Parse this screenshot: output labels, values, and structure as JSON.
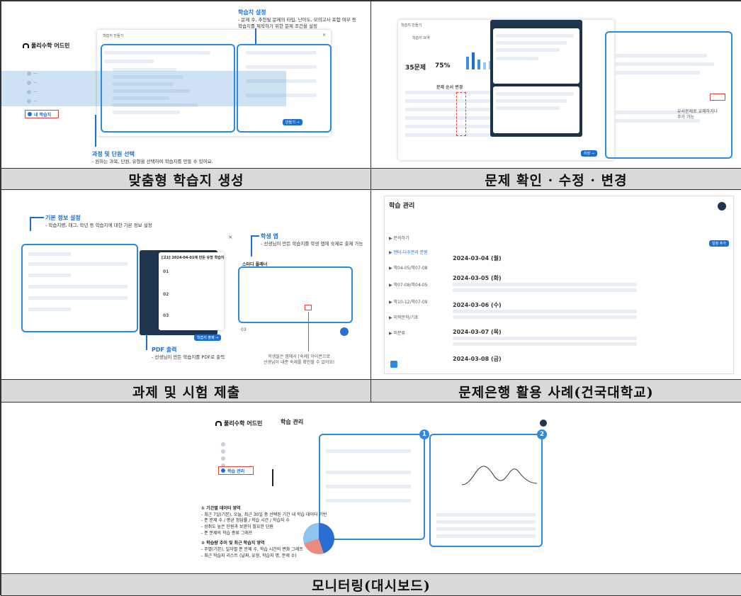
{
  "captions": {
    "c1": "맞춤형 학습지 생성",
    "c2": "문제 확인 · 수정 · 변경",
    "c3": "과제 및 시험 제출",
    "c4": "문제은행 활용 사례(건국대학교)",
    "c5": "모니터링(대시보드)"
  },
  "brand": "풀리수학 어드민",
  "p1": {
    "callout1_title": "학습지 설정",
    "callout1_desc1": "- 문제 수, 추천될 문제의 타입, 난이도, 모의고사 포함 여부 등",
    "callout1_desc2": "학습지를 제작하기 위한 문제 조건을 설정",
    "callout2_title": "과정 및 단원 선택",
    "callout2_desc": "- 원하는 과목, 단원, 유형을 선택하여 학습지를 만들 수 있어요.",
    "menu_active": "내 학습지",
    "modal_title": "학습지 만들기"
  },
  "p2": {
    "count_label": "35문제",
    "percent_label": "75%",
    "callout_order": "문제 순서 변경",
    "callout_replace1": "유사문제로 교체하거나",
    "callout_replace2": "추가 가능"
  },
  "p3": {
    "callout1_title": "기본 정보 설정",
    "callout1_desc": "- 학습지명, 태그, 학년 등 학습지에 대한 기본 정보 설정",
    "callout2_title": "학생 앱",
    "callout2_desc": "- 선생님이 만든 학습지를 학생 앱에 숙제로 출제 가능",
    "callout3_title": "PDF 출력",
    "callout3_desc": "- 선생님이 만든 학습지를 PDF로 출력",
    "worksheet_title": "[고1] 2024-04-01에 만든 유형 학습지",
    "app_title": "스터디 플래너",
    "red_note1": "학생들은 앱에서 [숙제] 아이콘으로",
    "red_note2": "선생님이 내준 숙제를 확인할 수 있어요!"
  },
  "p4": {
    "header": "학습 관리",
    "dates": [
      "2024-03-04 (월)",
      "2024-03-05 (화)",
      "2024-03-06 (수)",
      "2024-03-07 (목)",
      "2024-03-08 (금)"
    ],
    "sidebar_items": [
      "▶ 문의하기",
      "▶ 엔터-다수분리 분원",
      "▶ 학04-05/학07-08",
      "▶ 학07-08/학04-05",
      "▶ 학10-12/학07-09",
      "▶ 미적분학/기초",
      "▶ 미분류"
    ]
  },
  "p5": {
    "header": "학습 관리",
    "menu_active": "학습 관리",
    "notes": [
      "① 기간별 데이터 영역",
      "- 최근 7일(기본), 오늘, 최근 30일 중 선택된 기간 내 학습 데이터 기반",
      "- 푼 문제 수 / 평균 정답률 / 학습 시간 / 학습지 수",
      "- 성취도 높은 단원과 보완이 필요한 단원",
      "- 푼 문제의 학습 종류 그래프",
      "② 학습량 추이 및 최근 학습지 영역",
      "- 주별(기본), 일자별 푼 문제 수, 학습 시간의 변화 그래프",
      "- 최근 학습지 리스트 (날짜, 유형, 학습지 명, 문제 수)"
    ],
    "badge1": "1",
    "badge2": "2"
  },
  "colors": {
    "accent": "#1a6fd1",
    "highlight": "#e0443f",
    "caption_bg": "#d9d9d9"
  }
}
